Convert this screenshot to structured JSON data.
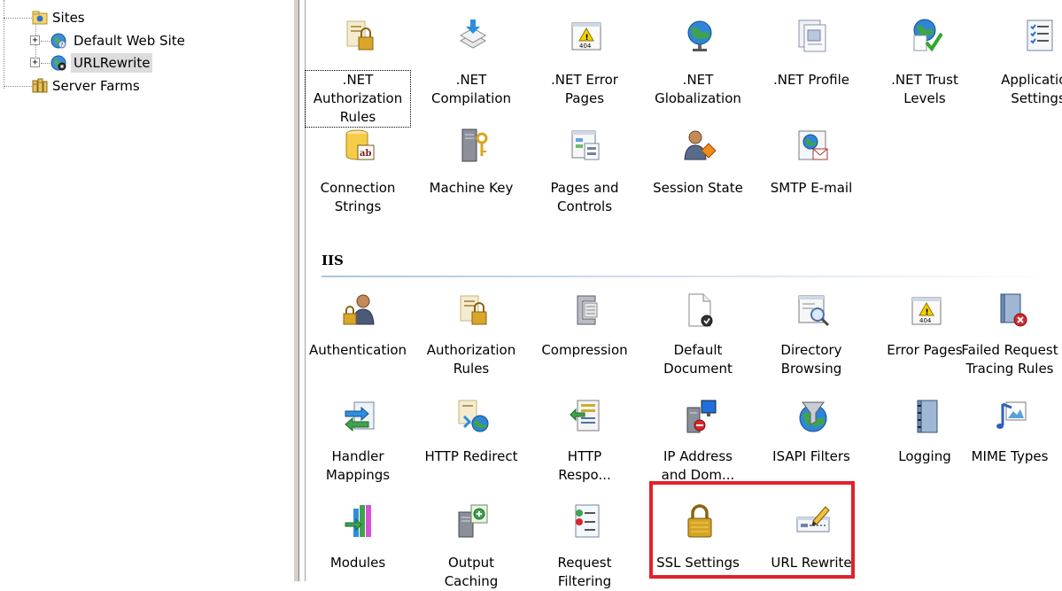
{
  "tree": {
    "nodes": [
      {
        "label": "Sites",
        "icon": "sites-folder-icon",
        "selected": false
      },
      {
        "label": "Default Web Site",
        "icon": "website-globe-icon",
        "selected": false
      },
      {
        "label": "URLRewrite",
        "icon": "website-globe-icon",
        "selected": true
      },
      {
        "label": "Server Farms",
        "icon": "server-farm-icon",
        "selected": false
      }
    ],
    "expand_glyph": "+",
    "collapse_glyph": "-"
  },
  "aspnet": {
    "features": [
      {
        "label": ".NET\nAuthorization\nRules",
        "icon": "lock-document-icon"
      },
      {
        "label": ".NET\nCompilation",
        "icon": "compilation-icon"
      },
      {
        "label": ".NET Error\nPages",
        "icon": "error-404-icon"
      },
      {
        "label": ".NET\nGlobalization",
        "icon": "globe-icon"
      },
      {
        "label": ".NET Profile",
        "icon": "profile-icon"
      },
      {
        "label": ".NET Trust\nLevels",
        "icon": "trust-globe-check-icon"
      },
      {
        "label": "Application\nSettings",
        "icon": "settings-list-icon"
      },
      {
        "label": "Connection\nStrings",
        "icon": "database-ab-icon"
      },
      {
        "label": "Machine Key",
        "icon": "server-key-icon"
      },
      {
        "label": "Pages and\nControls",
        "icon": "pages-controls-icon"
      },
      {
        "label": "Session State",
        "icon": "user-diamond-icon"
      },
      {
        "label": "SMTP E-mail",
        "icon": "mail-globe-icon"
      }
    ]
  },
  "iis": {
    "section_title": "IIS",
    "features": [
      {
        "label": "Authentication",
        "icon": "user-lock-icon"
      },
      {
        "label": "Authorization\nRules",
        "icon": "lock-document-icon"
      },
      {
        "label": "Compression",
        "icon": "clamp-icon"
      },
      {
        "label": "Default\nDocument",
        "icon": "document-check-icon"
      },
      {
        "label": "Directory\nBrowsing",
        "icon": "browse-magnifier-icon"
      },
      {
        "label": "Error Pages",
        "icon": "error-404-icon"
      },
      {
        "label": "Failed Request\nTracing Rules",
        "icon": "notebook-error-icon"
      },
      {
        "label": "Handler\nMappings",
        "icon": "handler-arrows-icon"
      },
      {
        "label": "HTTP Redirect",
        "icon": "redirect-globe-icon"
      },
      {
        "label": "HTTP\nRespo...",
        "icon": "response-arrow-icon"
      },
      {
        "label": "IP Address\nand Dom...",
        "icon": "ip-computer-icon"
      },
      {
        "label": "ISAPI Filters",
        "icon": "funnel-globe-icon"
      },
      {
        "label": "Logging",
        "icon": "notebook-icon"
      },
      {
        "label": "MIME Types",
        "icon": "music-image-icon"
      },
      {
        "label": "Modules",
        "icon": "modules-icon"
      },
      {
        "label": "Output\nCaching",
        "icon": "server-cache-icon"
      },
      {
        "label": "Request\nFiltering",
        "icon": "filter-list-icon"
      },
      {
        "label": "SSL Settings",
        "icon": "padlock-icon"
      },
      {
        "label": "URL Rewrite",
        "icon": "url-rewrite-pencil-icon"
      }
    ]
  },
  "colors": {
    "highlight_border": "#e0212b",
    "selection_bg": "#dcdcdc",
    "section_rule": "#a9c4e4"
  }
}
